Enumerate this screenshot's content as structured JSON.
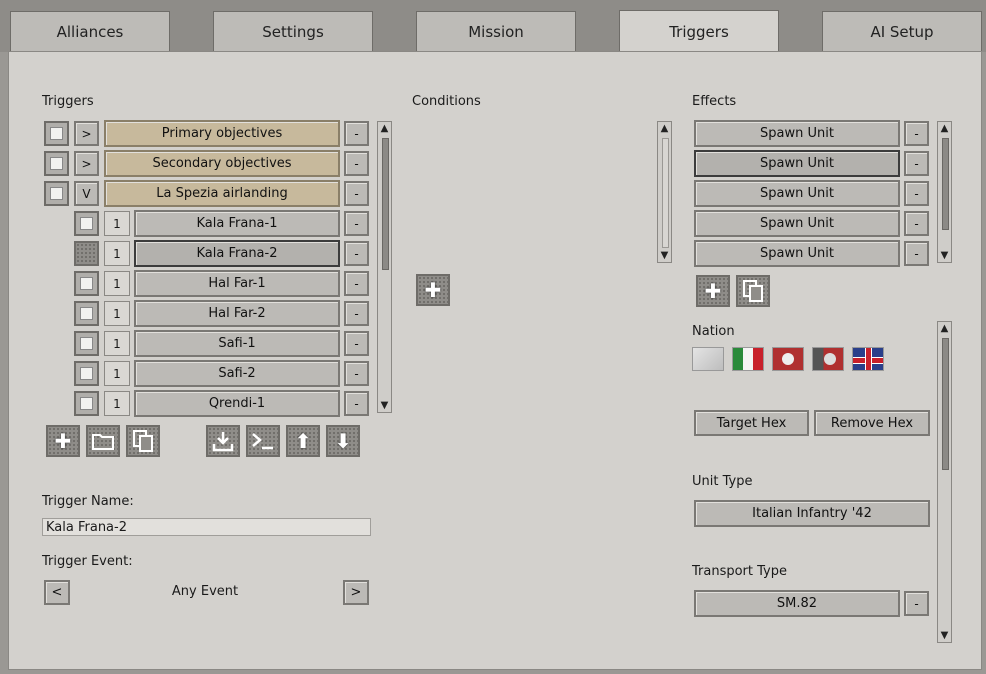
{
  "tabs": [
    "Alliances",
    "Settings",
    "Mission",
    "Triggers",
    "AI Setup"
  ],
  "active_tab": "Triggers",
  "triggers": {
    "heading": "Triggers",
    "groups": [
      {
        "expander": ">",
        "label": "Primary objectives"
      },
      {
        "expander": ">",
        "label": "Secondary objectives"
      },
      {
        "expander": "V",
        "label": "La Spezia airlanding"
      }
    ],
    "children": [
      {
        "num": "1",
        "label": "Kala Frana-1"
      },
      {
        "num": "1",
        "label": "Kala Frana-2"
      },
      {
        "num": "1",
        "label": "Hal Far-1"
      },
      {
        "num": "1",
        "label": "Hal Far-2"
      },
      {
        "num": "1",
        "label": "Safi-1"
      },
      {
        "num": "1",
        "label": "Safi-2"
      },
      {
        "num": "1",
        "label": "Qrendi-1"
      }
    ],
    "remove_label": "-"
  },
  "conditions": {
    "heading": "Conditions"
  },
  "effects": {
    "heading": "Effects",
    "items": [
      "Spawn Unit",
      "Spawn Unit",
      "Spawn Unit",
      "Spawn Unit",
      "Spawn Unit"
    ],
    "remove_label": "-"
  },
  "trigger_name": {
    "label": "Trigger Name:",
    "value": "Kala Frana-2"
  },
  "trigger_event": {
    "label": "Trigger Event:",
    "value": "Any Event",
    "prev": "<",
    "next": ">"
  },
  "nation": {
    "label": "Nation",
    "flags": [
      "neutral-flag",
      "italy-flag",
      "germany-flag",
      "germany-alt-flag",
      "uk-flag"
    ]
  },
  "hex_buttons": {
    "target": "Target Hex",
    "remove": "Remove Hex"
  },
  "unit_type": {
    "label": "Unit Type",
    "value": "Italian Infantry '42"
  },
  "transport_type": {
    "label": "Transport Type",
    "value": "SM.82",
    "remove": "-"
  },
  "scroll_up": "▲",
  "scroll_down": "▼",
  "colors": {
    "tan_row": "#c7b99c",
    "panel": "#d3d1cd"
  }
}
